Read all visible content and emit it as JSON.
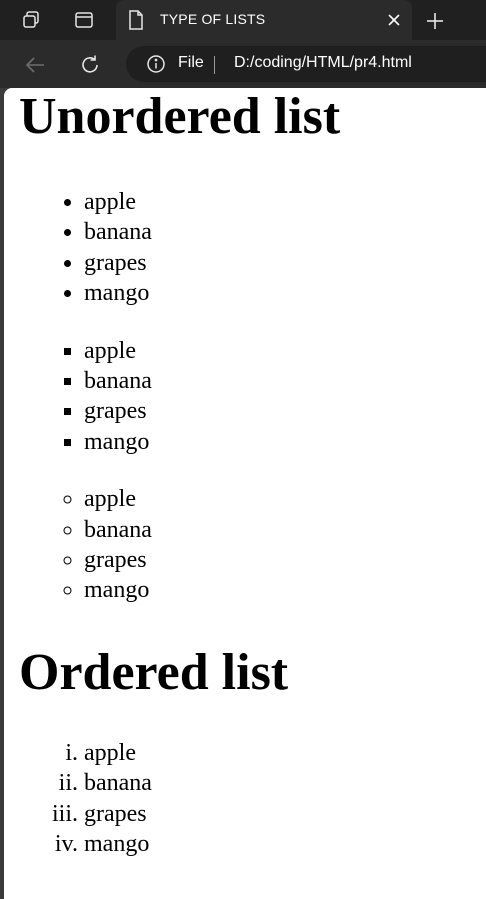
{
  "browser": {
    "tab": {
      "title": "TYPE OF LISTS"
    },
    "address": {
      "scheme": "File",
      "url": "D:/coding/HTML/pr4.html"
    },
    "icons": [
      "workspaces-icon",
      "tab-actions-icon",
      "document-icon",
      "close-icon",
      "new-tab-icon",
      "back-icon",
      "refresh-icon",
      "info-icon"
    ],
    "colors": {
      "tabbar": "#202020",
      "toolbar": "#2b2b2b",
      "omnibox": "#1f1f1f",
      "page": "#ffffff"
    }
  },
  "page": {
    "heading_unordered": "Unordered list",
    "disc_list": [
      "apple",
      "banana",
      "grapes",
      "mango"
    ],
    "square_list": [
      "apple",
      "banana",
      "grapes",
      "mango"
    ],
    "circle_list": [
      "apple",
      "banana",
      "grapes",
      "mango"
    ],
    "heading_ordered": "Ordered list",
    "roman_list": [
      "apple",
      "banana",
      "grapes",
      "mango"
    ]
  }
}
